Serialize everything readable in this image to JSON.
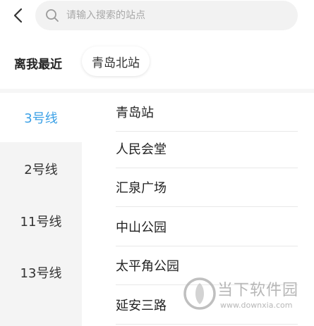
{
  "search": {
    "placeholder": "请输入搜索的站点",
    "value": ""
  },
  "nearby": {
    "label": "离我最近",
    "station": "青岛北站"
  },
  "lines": [
    {
      "label": "3号线",
      "active": true
    },
    {
      "label": "2号线",
      "active": false
    },
    {
      "label": "11号线",
      "active": false
    },
    {
      "label": "13号线",
      "active": false
    }
  ],
  "stations": [
    "青岛站",
    "人民会堂",
    "汇泉广场",
    "中山公园",
    "太平角公园",
    "延安三路"
  ],
  "watermark": {
    "title": "当下软件园",
    "url": "www.downxia.com"
  },
  "colors": {
    "accent": "#3aa0e6",
    "sidebar_bg": "#f4f4f4",
    "search_bg": "#f2f2f2"
  },
  "icons": {
    "back": "chevron-left-icon",
    "search": "search-icon",
    "watermark_logo": "watermark-logo-icon"
  }
}
